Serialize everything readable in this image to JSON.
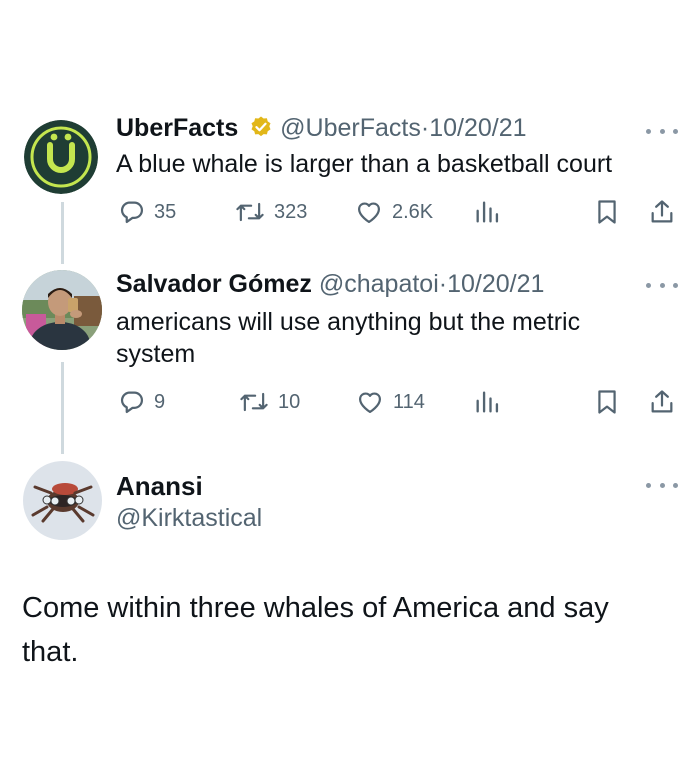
{
  "tweets": [
    {
      "name": "UberFacts",
      "verified": true,
      "handle": "@UberFacts",
      "date": "10/20/21",
      "separator": "·",
      "text": "A blue whale is larger than a basketball court",
      "replies": "35",
      "retweets": "323",
      "likes": "2.6K"
    },
    {
      "name": "Salvador Gómez",
      "handle": "@chapatoi",
      "date": "10/20/21",
      "separator": "·",
      "text": "americans will use anything but the metric system",
      "replies": "9",
      "retweets": "10",
      "likes": "114"
    }
  ],
  "reply": {
    "name": "Anansi",
    "handle": "@Kirktastical",
    "text": "Come within three whales of America and say that."
  },
  "colors": {
    "text": "#0f1419",
    "muted": "#536471",
    "thread_line": "#cfd9de",
    "verified_badge": "#e2b719",
    "uber_green": "#1f3d34",
    "uber_lime": "#c4e64f"
  },
  "icons": [
    "reply-icon",
    "retweet-icon",
    "like-icon",
    "views-icon",
    "bookmark-icon",
    "share-icon",
    "more-icon",
    "verified-badge-icon"
  ]
}
